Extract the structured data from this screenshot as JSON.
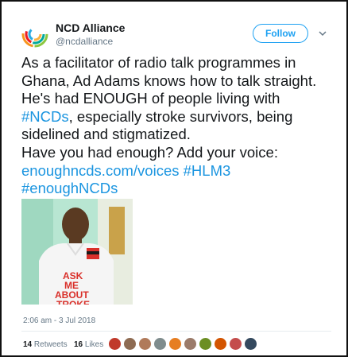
{
  "author": {
    "name": "NCD Alliance",
    "handle": "@ncdalliance",
    "follow_label": "Follow"
  },
  "tweet": {
    "line1": "As a facilitator of radio talk programmes in",
    "line2": "Ghana, Ad Adams knows how to talk straight.",
    "line3": "He's had ENOUGH of people living with",
    "hashtag_ncds": "#NCDs",
    "line4_rest": ", especially stroke survivors, being",
    "line5": "sidelined and stigmatized.",
    "line6": "Have you had enough? Add your voice:",
    "link_url": "enoughncds.com/voices",
    "hashtag_hlm3": "#HLM3",
    "hashtag_enough": "#enoughNCDs"
  },
  "photo": {
    "shirt_text": [
      "ASK",
      "ME",
      "ABOUT",
      "TROKE"
    ]
  },
  "meta": {
    "timestamp": "2:06 am - 3 Jul 2018",
    "retweets_count": "14",
    "retweets_label": "Retweets",
    "likes_count": "16",
    "likes_label": "Likes"
  },
  "colors": {
    "accent": "#1da1f2",
    "link": "#1b95e0",
    "text": "#14171a",
    "muted": "#657786"
  },
  "likers": [
    "liker-1",
    "liker-2",
    "liker-3",
    "liker-4",
    "liker-5",
    "liker-6",
    "liker-7",
    "liker-8",
    "liker-9",
    "liker-10"
  ]
}
